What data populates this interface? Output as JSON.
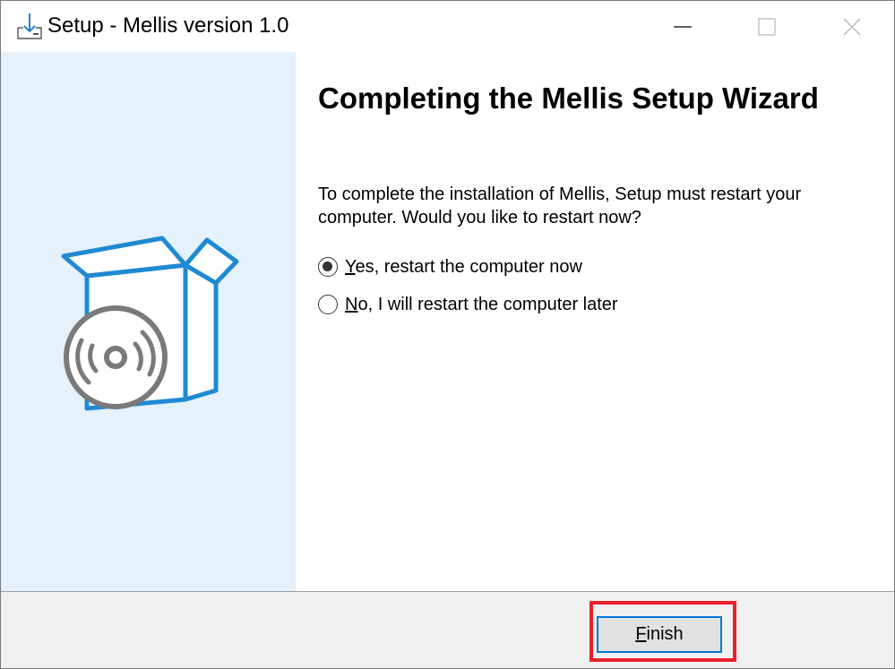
{
  "window": {
    "title": "Setup - Mellis version 1.0",
    "icon": "installer-download-icon",
    "controls": [
      "minimize-icon",
      "maximize-icon",
      "close-icon"
    ]
  },
  "main": {
    "heading": "Completing the Mellis Setup Wizard",
    "description": "To complete the installation of Mellis, Setup must restart your computer. Would you like to restart now?",
    "options": [
      {
        "accesskey": "Y",
        "rest": "es, restart the computer now",
        "selected": true
      },
      {
        "accesskey": "N",
        "rest": "o, I will restart the computer later",
        "selected": false
      }
    ]
  },
  "footer": {
    "finish_accesskey": "F",
    "finish_rest": "inish"
  },
  "colors": {
    "sidebar_bg": "#e5f1fb",
    "accent": "#0078d7",
    "box_blue": "#1f8ad2",
    "disc_gray": "#7a7a7a",
    "highlight": "#e8202b"
  },
  "sidebar": {
    "art": "software-box-with-disc-icon"
  }
}
